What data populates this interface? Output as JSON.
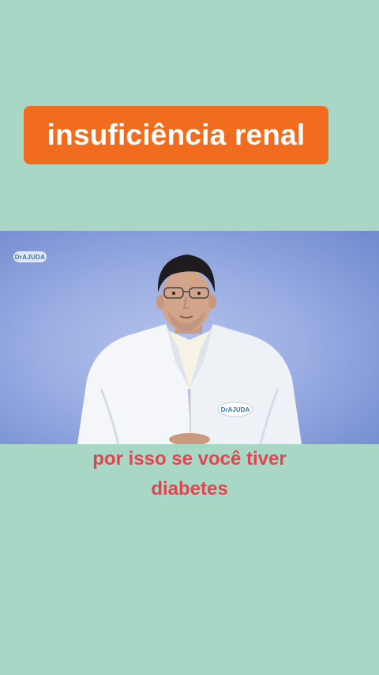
{
  "title": {
    "text": "insuficiência renal",
    "background_color": "#f26c1f",
    "text_color": "#ffffff"
  },
  "video": {
    "logo_text": "DrAJUDA",
    "coat_logo_text": "DrAJUDA"
  },
  "caption": {
    "lines": [
      "por isso se você tiver",
      "diabetes"
    ],
    "color": "#e2454f"
  },
  "page_background": "#a9d7c6"
}
